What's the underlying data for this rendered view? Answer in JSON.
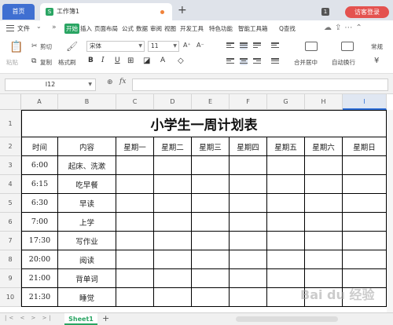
{
  "titlebar": {
    "home_tab": "首页",
    "doc_icon": "S",
    "doc_tab": "工作簿1",
    "new_tab": "+",
    "badge": "1",
    "login": "访客登录"
  },
  "menu": {
    "file": "文件",
    "items": [
      "开始",
      "插入",
      "页面布局",
      "公式",
      "数据",
      "审阅",
      "视图",
      "开发工具",
      "特色功能",
      "智能工具箱"
    ],
    "search": "Q查找"
  },
  "ribbon": {
    "paste": "粘贴",
    "cut": "剪切",
    "copy": "复制",
    "format_painter": "格式刷",
    "font_name": "宋体",
    "font_size": "11",
    "bold": "B",
    "italic": "I",
    "underline": "U",
    "font_color": "A",
    "merge_center": "合并居中",
    "auto_wrap": "自动换行",
    "normal": "常规",
    "grow": "A⁺",
    "shrink": "A⁻"
  },
  "formula_bar": {
    "cell_ref": "I12",
    "fx": "fx",
    "formula": ""
  },
  "sheet": {
    "columns": [
      "A",
      "B",
      "C",
      "D",
      "E",
      "F",
      "G",
      "H",
      "I"
    ],
    "selected_column": "I",
    "row_numbers": [
      "1",
      "2",
      "3",
      "4",
      "5",
      "6",
      "7",
      "8",
      "9",
      "10"
    ],
    "title": "小学生一周计划表",
    "headers": [
      "时间",
      "内容",
      "星期一",
      "星期二",
      "星期三",
      "星期四",
      "星期五",
      "星期六",
      "星期日"
    ],
    "rows": [
      [
        "6:00",
        "起床、洗漱"
      ],
      [
        "6:15",
        "吃早餐"
      ],
      [
        "6:30",
        "早读"
      ],
      [
        "7:00",
        "上学"
      ],
      [
        "17:30",
        "写作业"
      ],
      [
        "20:00",
        "阅读"
      ],
      [
        "21:00",
        "背单词"
      ],
      [
        "21:30",
        "睡觉"
      ]
    ]
  },
  "bottom": {
    "sheet_tab": "Sheet1",
    "add_sheet": "+",
    "nav": "|< < > >|"
  },
  "watermark": "Bai du 经验",
  "colors": {
    "accent_green": "#2aa563",
    "home_tab_blue": "#3f6fd1",
    "login_red": "#e4524f",
    "selected_column_blue": "#2f6fd8"
  }
}
